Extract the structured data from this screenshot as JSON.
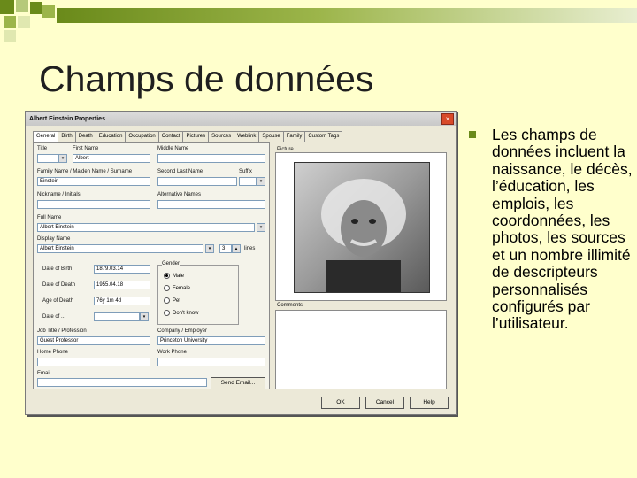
{
  "slide": {
    "title": "Champs de données",
    "body": "Les champs de données incluent la naissance, le décès, l’éducation, les emplois, les coordonnées, les photos, les sources et un nombre illimité de descripteurs personnalisés configurés par l’utilisateur."
  },
  "dialog": {
    "title": "Albert Einstein Properties",
    "close": "×",
    "tabs": [
      "General",
      "Birth",
      "Death",
      "Education",
      "Occupation",
      "Contact",
      "Pictures",
      "Sources",
      "Weblink",
      "Spouse",
      "Family",
      "Custom Tags"
    ],
    "fields": {
      "title_label": "Title",
      "title_value": "",
      "first_name_label": "First Name",
      "first_name_value": "Albert",
      "middle_name_label": "Middle Name",
      "middle_name_value": "",
      "family_name_label": "Family Name / Maiden Name / Surname",
      "family_name_value": "Einstein",
      "second_last_label": "Second Last Name",
      "second_last_value": "",
      "suffix_label": "Suffix",
      "suffix_value": "",
      "nickname_label": "Nickname / Initials",
      "nickname_value": "",
      "alt_names_label": "Alternative Names",
      "alt_names_value": "",
      "full_name_label": "Full Name",
      "full_name_value": "Albert Einstein",
      "display_name_label": "Display Name",
      "display_name_value": "Albert Einstein",
      "lines_value": "3",
      "lines_label": "lines",
      "dob_label": "Date of Birth",
      "dob_value": "1879.03.14",
      "dod_label": "Date of Death",
      "dod_value": "1955.04.18",
      "age_label": "Age of Death",
      "age_value": "76y 1m 4d",
      "dob2_label": "Date of ...",
      "dob2_value": "",
      "job_label": "Job Title / Profession",
      "job_value": "Guest Professor",
      "company_label": "Company / Employer",
      "company_value": "Princeton University",
      "home_phone_label": "Home Phone",
      "home_phone_value": "",
      "work_phone_label": "Work Phone",
      "work_phone_value": "",
      "email_label": "Email",
      "email_value": ""
    },
    "gender": {
      "label": "Gender",
      "options": [
        "Male",
        "Female",
        "Pet",
        "Don't know"
      ],
      "selected": "Male"
    },
    "picture_label": "Picture",
    "notes_label": "Comments",
    "send_email_label": "Send Email...",
    "ok_label": "OK",
    "cancel_label": "Cancel",
    "help_label": "Help"
  },
  "colors": {
    "background": "#ffffcc",
    "accent": "#6a8a1a"
  }
}
